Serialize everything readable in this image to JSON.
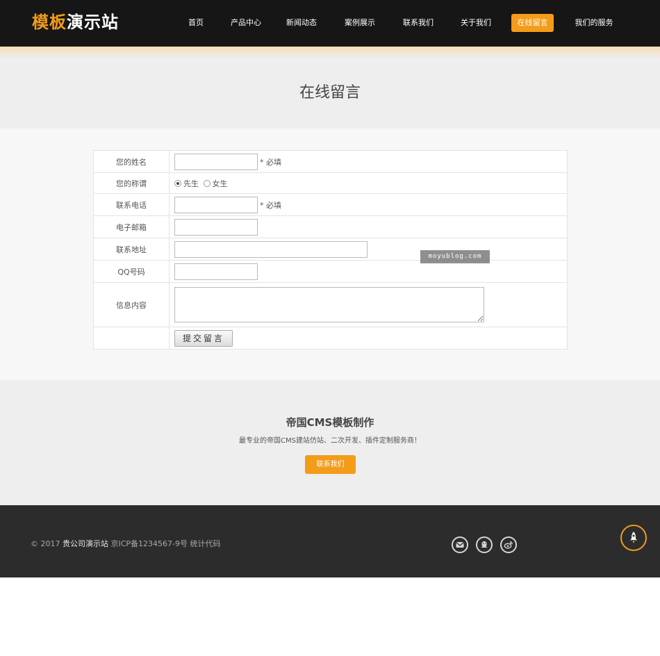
{
  "header": {
    "logo_part1": "模板",
    "logo_part2": "演示站",
    "nav": [
      {
        "label": "首页"
      },
      {
        "label": "产品中心"
      },
      {
        "label": "新闻动态"
      },
      {
        "label": "案例展示"
      },
      {
        "label": "联系我们"
      },
      {
        "label": "关于我们"
      },
      {
        "label": "在线留言",
        "active": true
      },
      {
        "label": "我们的服务"
      }
    ]
  },
  "page": {
    "title": "在线留言"
  },
  "form": {
    "name_label": "您的姓名",
    "title_label": "您的称谓",
    "gender_options": [
      "先生",
      "女生"
    ],
    "gender_selected": "先生",
    "phone_label": "联系电话",
    "email_label": "电子邮箱",
    "address_label": "联系地址",
    "qq_label": "QQ号码",
    "content_label": "信息内容",
    "required_note": "* 必填",
    "submit_label": "提交留言",
    "values": {
      "name": "",
      "phone": "",
      "email": "",
      "address": "",
      "qq": "",
      "content": ""
    }
  },
  "watermark": "moyublog.com",
  "promo": {
    "title": "帝国CMS模板制作",
    "subtitle": "最专业的帝国CMS建站仿站、二次开发、插件定制服务商！",
    "button": "联系我们"
  },
  "footer": {
    "copyright": "© 2017",
    "company": "贵公司演示站",
    "icp": "京ICP备1234567-9号",
    "stats": "统计代码",
    "social_icons": [
      "envelope-icon",
      "qq-icon",
      "weibo-icon"
    ]
  },
  "colors": {
    "accent": "#f39c1a",
    "header_bg": "#161616",
    "footer_bg": "#2c2c2c"
  }
}
